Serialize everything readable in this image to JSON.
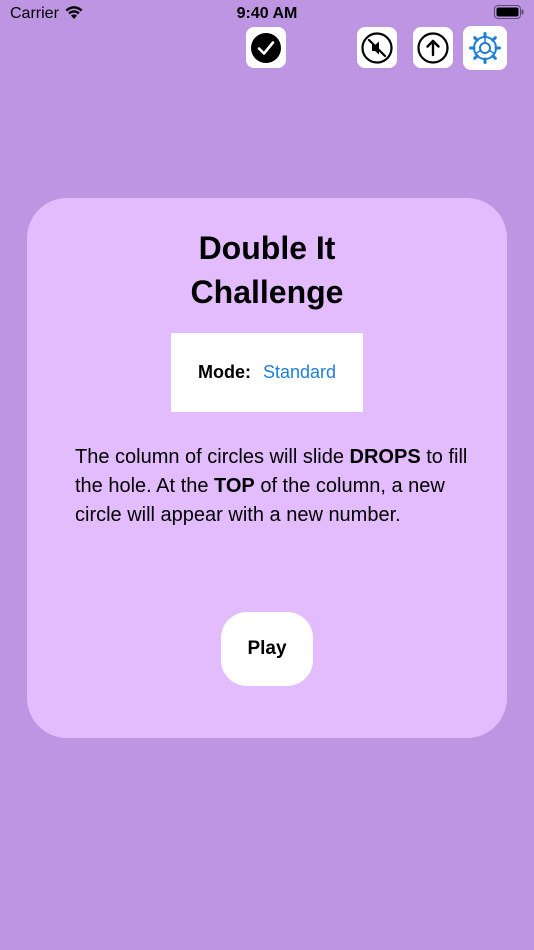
{
  "status_bar": {
    "carrier": "Carrier",
    "time": "9:40 AM"
  },
  "toolbar": {
    "icons": [
      "check-circle-icon",
      "mute-icon",
      "upload-icon",
      "gear-icon"
    ]
  },
  "card": {
    "title_line1": "Double It",
    "title_line2": "Challenge",
    "mode_label": "Mode:",
    "mode_value": "Standard",
    "description": {
      "p1": "The column of circles will slide ",
      "b1": "DROPS",
      "p2": " to fill the hole.  At the ",
      "b2": "TOP",
      "p3": " of the column, a new circle will appear with a new number."
    },
    "play_label": "Play"
  },
  "colors": {
    "background": "#BD95E3",
    "card": "#E2BCFD",
    "accent_blue": "#1E7FD9"
  }
}
